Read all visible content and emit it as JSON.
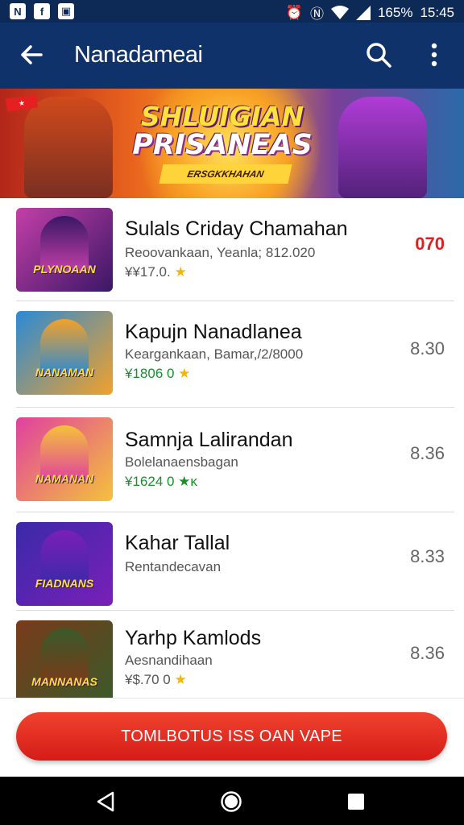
{
  "status_bar": {
    "battery": "165%",
    "time": "15:45"
  },
  "app_bar": {
    "title": "Nanadameai"
  },
  "banner": {
    "title_line1": "SHLUIGIAN",
    "title_line2": "PRISANEAS",
    "subtitle": "ERSGKKHAHAN"
  },
  "items": [
    {
      "name": "Sulals Criday Chamahan",
      "subtitle": "Reoovankaan, Yeanla; 812.020",
      "meta": "¥¥17.0.",
      "meta_color": "gray",
      "rating_icon": "star",
      "price": "070",
      "price_color": "#e02020",
      "thumb_label": "PLYNOAAN",
      "thumb_colors": [
        "#c43fa8",
        "#3a1766"
      ]
    },
    {
      "name": "Kapujn Nanadlanea",
      "subtitle": "Keargankaan, Bamar,/2/8000",
      "meta": "¥1806 0",
      "meta_color": "green",
      "rating_icon": "star",
      "price": "8.30",
      "price_color": "#666666",
      "thumb_label": "NANAMAN",
      "thumb_colors": [
        "#2a8ad6",
        "#f2a12a"
      ]
    },
    {
      "name": "Samnja Lalirandan",
      "subtitle": "Bolelanaensbagan",
      "meta": "¥1624 0 ★ᴋ",
      "meta_color": "green",
      "rating_icon": "none",
      "price": "8.36",
      "price_color": "#666666",
      "thumb_label": "NAMANAN",
      "thumb_colors": [
        "#e040a0",
        "#f5c23a"
      ]
    },
    {
      "name": "Kahar Tallal",
      "subtitle": "Rentandecavan",
      "meta": "",
      "meta_color": "gray",
      "rating_icon": "none",
      "price": "8.33",
      "price_color": "#666666",
      "thumb_label": "FIADNANS",
      "thumb_colors": [
        "#3a2aa8",
        "#7a1fb8"
      ]
    },
    {
      "name": "Yarhp Kamlods",
      "subtitle": "Aesnandihaan",
      "meta": "¥$.70 0",
      "meta_color": "gray",
      "rating_icon": "star",
      "price": "8.36",
      "price_color": "#666666",
      "thumb_label": "MANNANAS",
      "thumb_colors": [
        "#7a3a1a",
        "#3a5a2a"
      ]
    }
  ],
  "cta": {
    "label": "TOMLBOTUS ISS OAN VAPE"
  },
  "colors": {
    "app_bar": "#10326a",
    "status_bar": "#0d2a57",
    "cta": "#e02a22",
    "star": "#f2b800"
  }
}
